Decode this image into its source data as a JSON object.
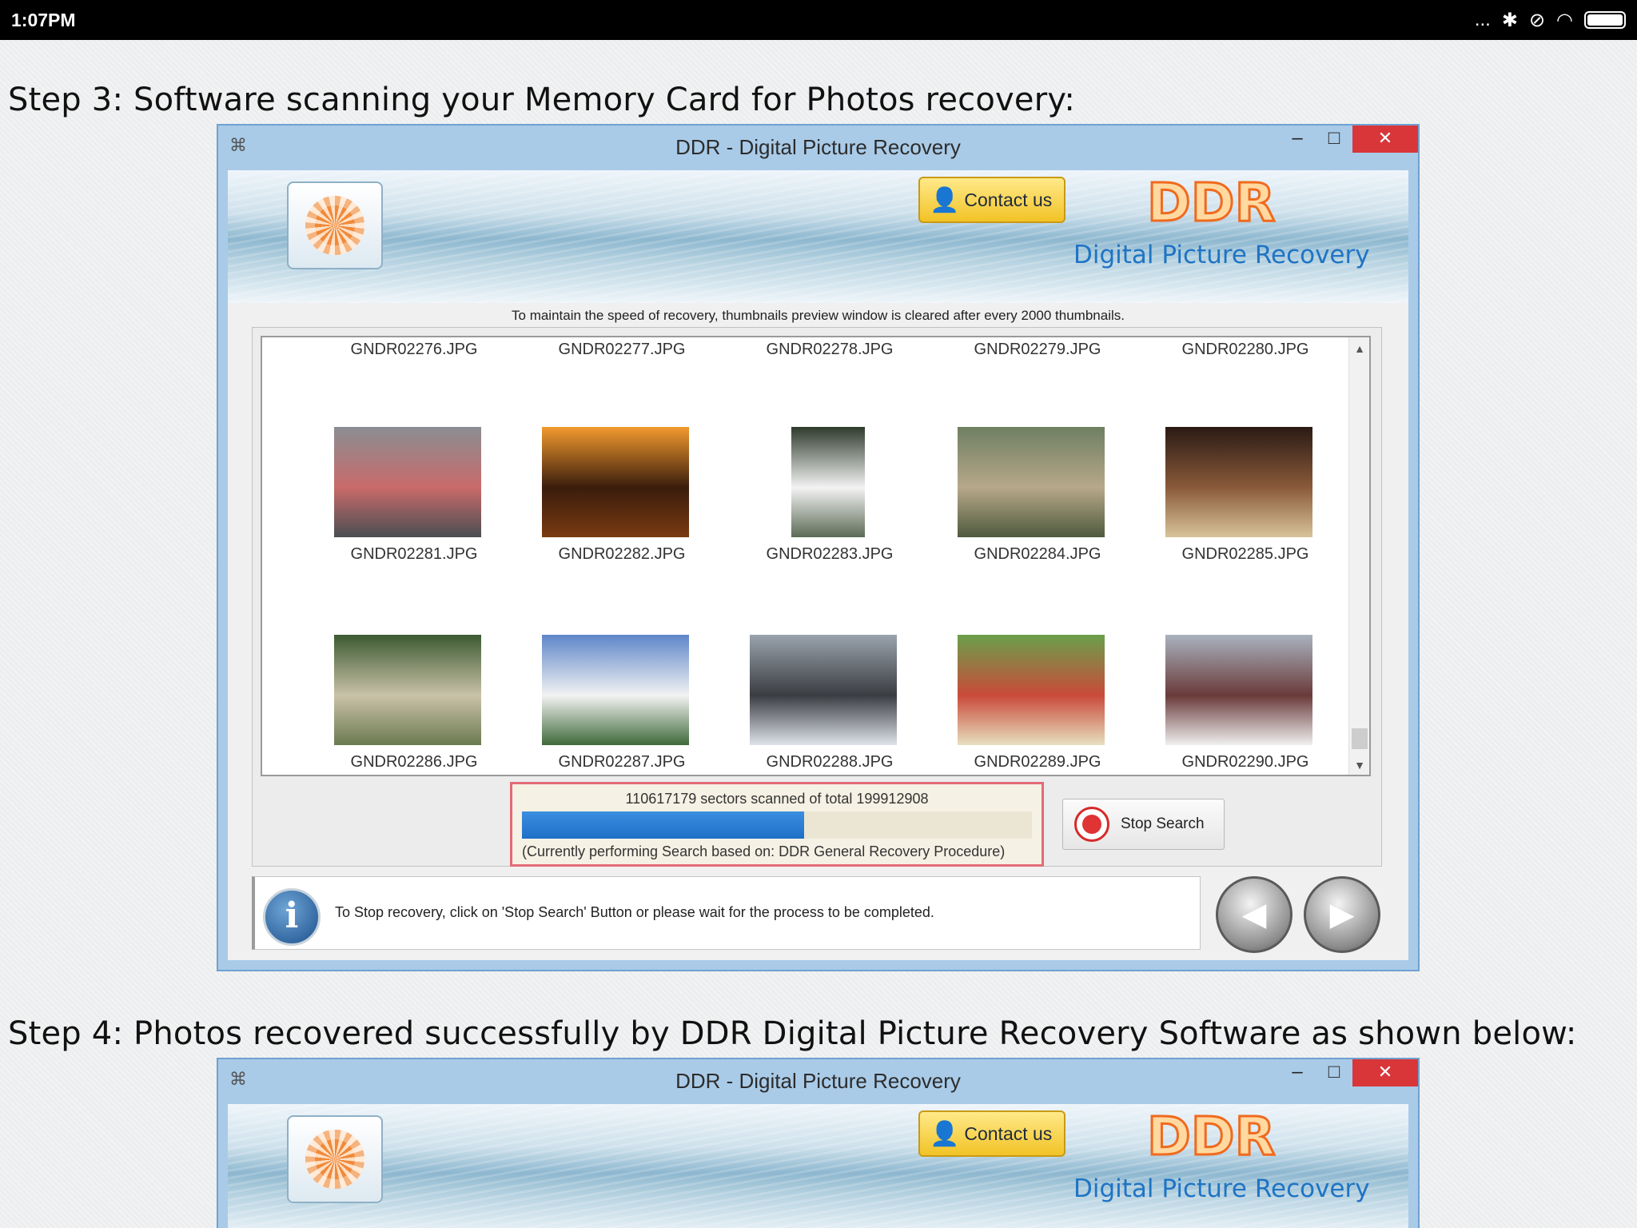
{
  "status_bar": {
    "time": "1:07PM",
    "overflow": "...",
    "icons": [
      "bluetooth-icon",
      "mute-icon",
      "wifi-icon",
      "battery-icon"
    ]
  },
  "step3": {
    "heading": "Step 3: Software scanning your Memory Card for Photos recovery:"
  },
  "step4": {
    "heading": "Step 4: Photos recovered successfully by DDR Digital Picture Recovery Software as shown below:"
  },
  "window": {
    "title": "DDR - Digital Picture Recovery",
    "minimize": "–",
    "maximize": "□",
    "close": "✕",
    "contact_label": "Contact us",
    "brand": "DDR",
    "brand_subtitle": "Digital Picture Recovery"
  },
  "scan": {
    "note": "To maintain the speed of recovery, thumbnails preview window is cleared after every 2000 thumbnails.",
    "files": [
      "GNDR02276.JPG",
      "GNDR02277.JPG",
      "GNDR02278.JPG",
      "GNDR02279.JPG",
      "GNDR02280.JPG",
      "GNDR02281.JPG",
      "GNDR02282.JPG",
      "GNDR02283.JPG",
      "GNDR02284.JPG",
      "GNDR02285.JPG",
      "GNDR02286.JPG",
      "GNDR02287.JPG",
      "GNDR02288.JPG",
      "GNDR02289.JPG",
      "GNDR02290.JPG"
    ],
    "progress_text": "110617179 sectors scanned of total 199912908",
    "progress_fraction": 0.5533,
    "procedure_text": "(Currently performing Search based on:  DDR General Recovery Procedure)",
    "stop_label": "Stop Search",
    "info_text": "To Stop recovery, click on 'Stop Search' Button or please wait for the process to be completed."
  },
  "colors": {
    "accent": "#1f74c4",
    "close": "#d9363a",
    "progress": "#2a7fd8",
    "highlight": "#e46a78"
  }
}
